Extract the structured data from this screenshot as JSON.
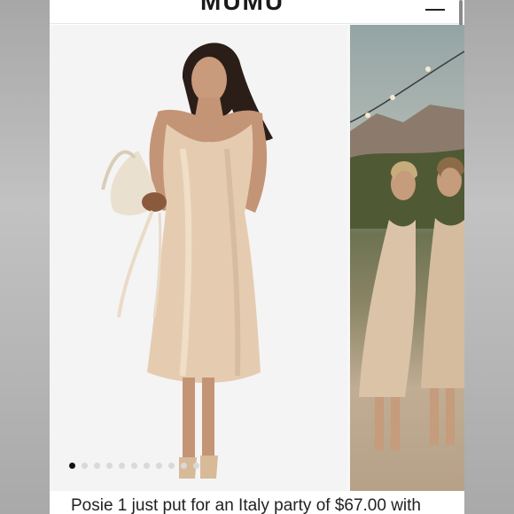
{
  "header": {
    "logo_text": "MUMU"
  },
  "gallery": {
    "slide_count": 11,
    "active_slide": 1
  },
  "description": {
    "text": "Posie 1 just put for an Italy party of $67.00 with"
  },
  "colors": {
    "dress": "#e6cdb3",
    "active_dot": "#111111",
    "inactive_dot": "#d9d9d9"
  }
}
